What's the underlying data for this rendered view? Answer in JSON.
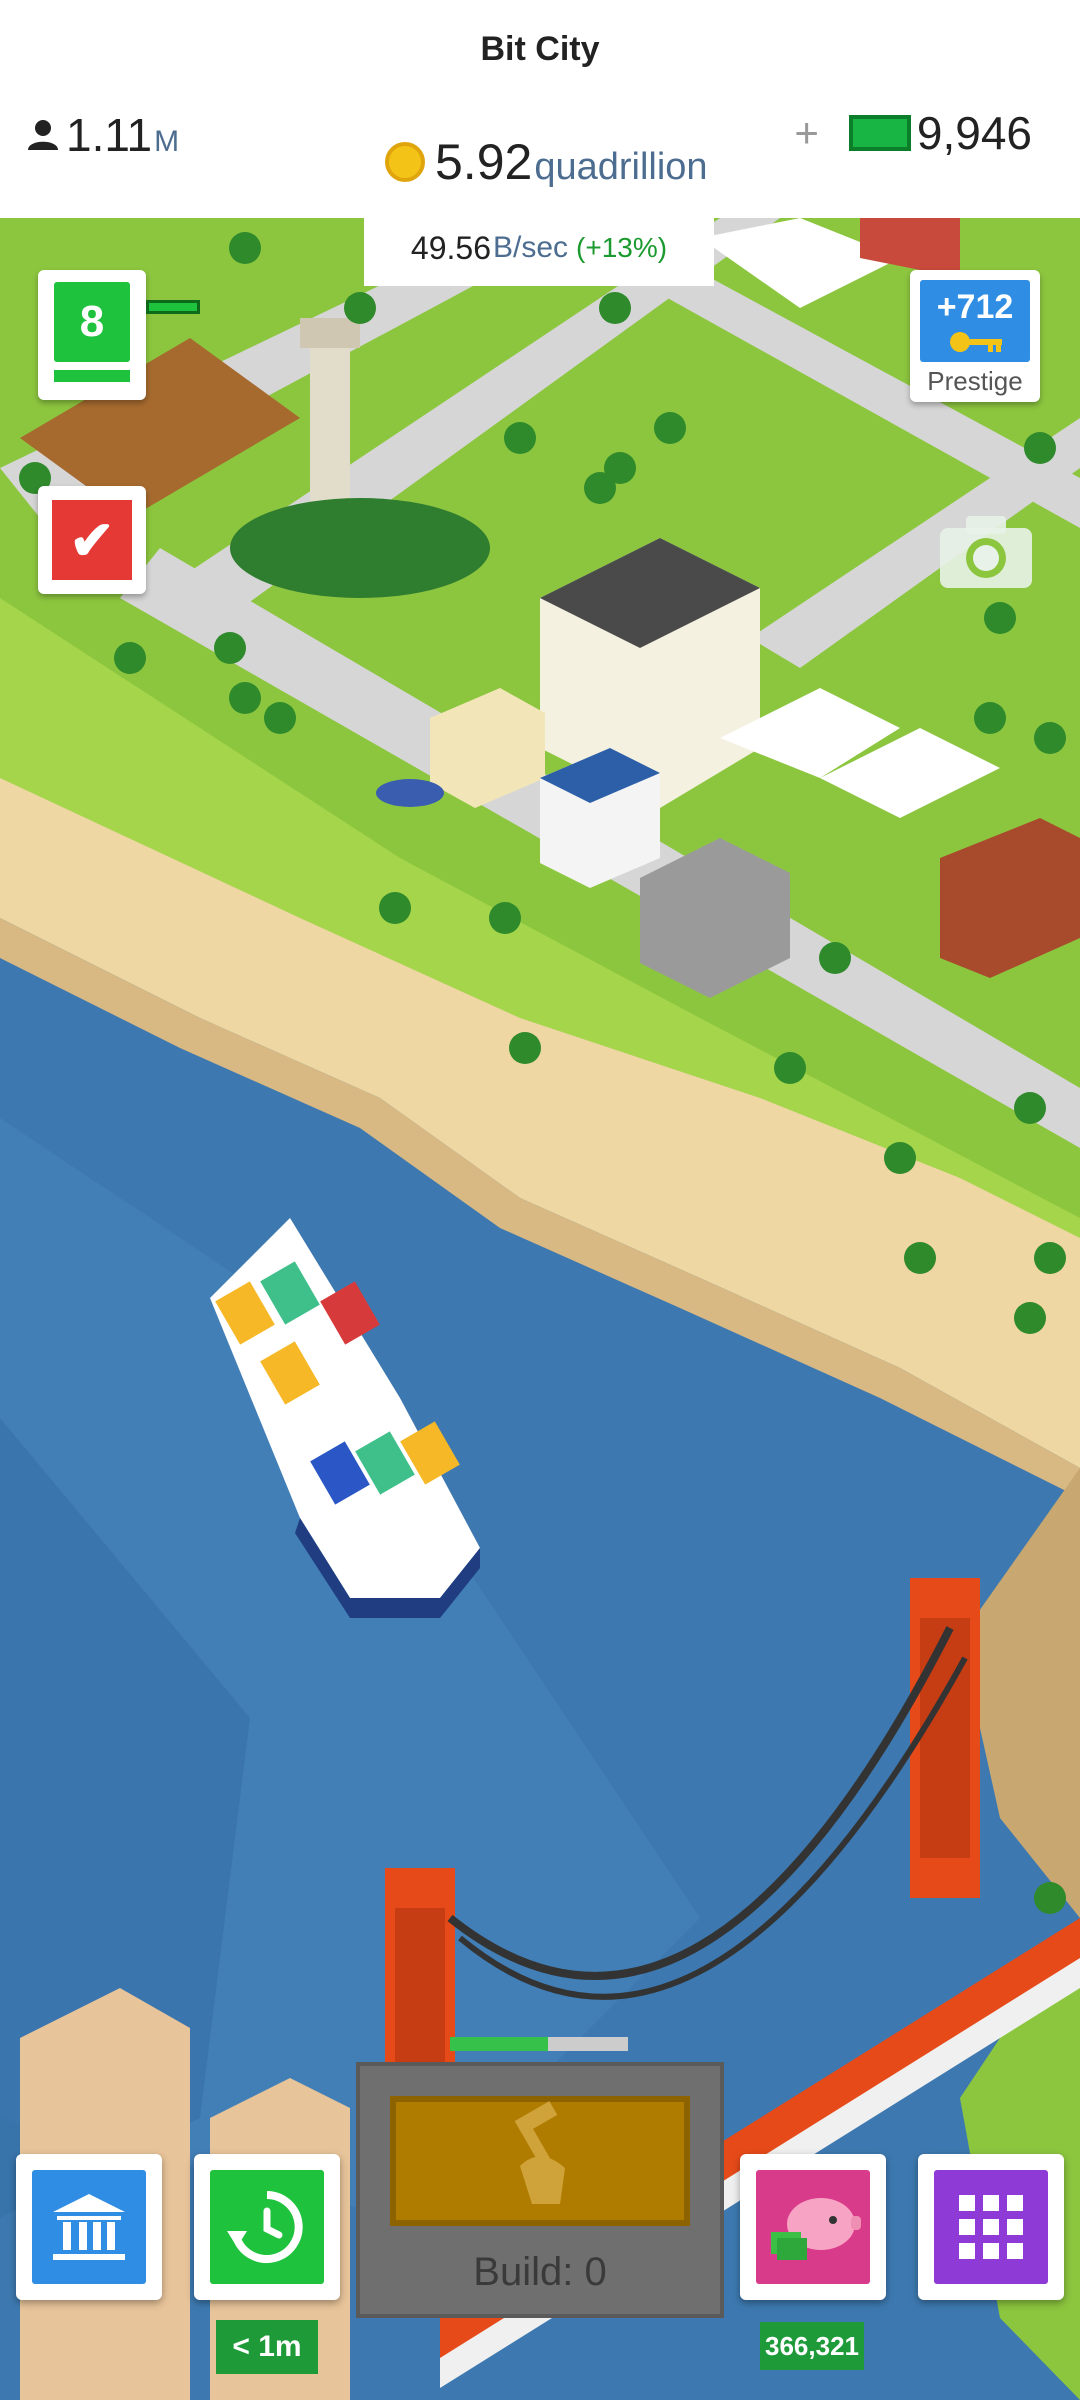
{
  "header": {
    "title": "Bit City",
    "population": "1.11",
    "population_unit": "M",
    "coins": "5.92",
    "coins_unit": "quadrillion",
    "cash": "9,946",
    "plus": "+"
  },
  "rate": {
    "value": "49.56",
    "unit": "B/sec",
    "bonus": "(+13%)"
  },
  "city_level": {
    "value": "8"
  },
  "prestige": {
    "value": "+712",
    "label": "Prestige"
  },
  "build": {
    "label": "Build: 0",
    "progress": 0.55
  },
  "bottom": {
    "timer_badge": "< 1m",
    "bank_badge": "366,321"
  },
  "colors": {
    "grass": "#8cc63f",
    "water": "#3d79b0",
    "accent_green": "#1fc23c",
    "accent_red": "#e53935"
  }
}
